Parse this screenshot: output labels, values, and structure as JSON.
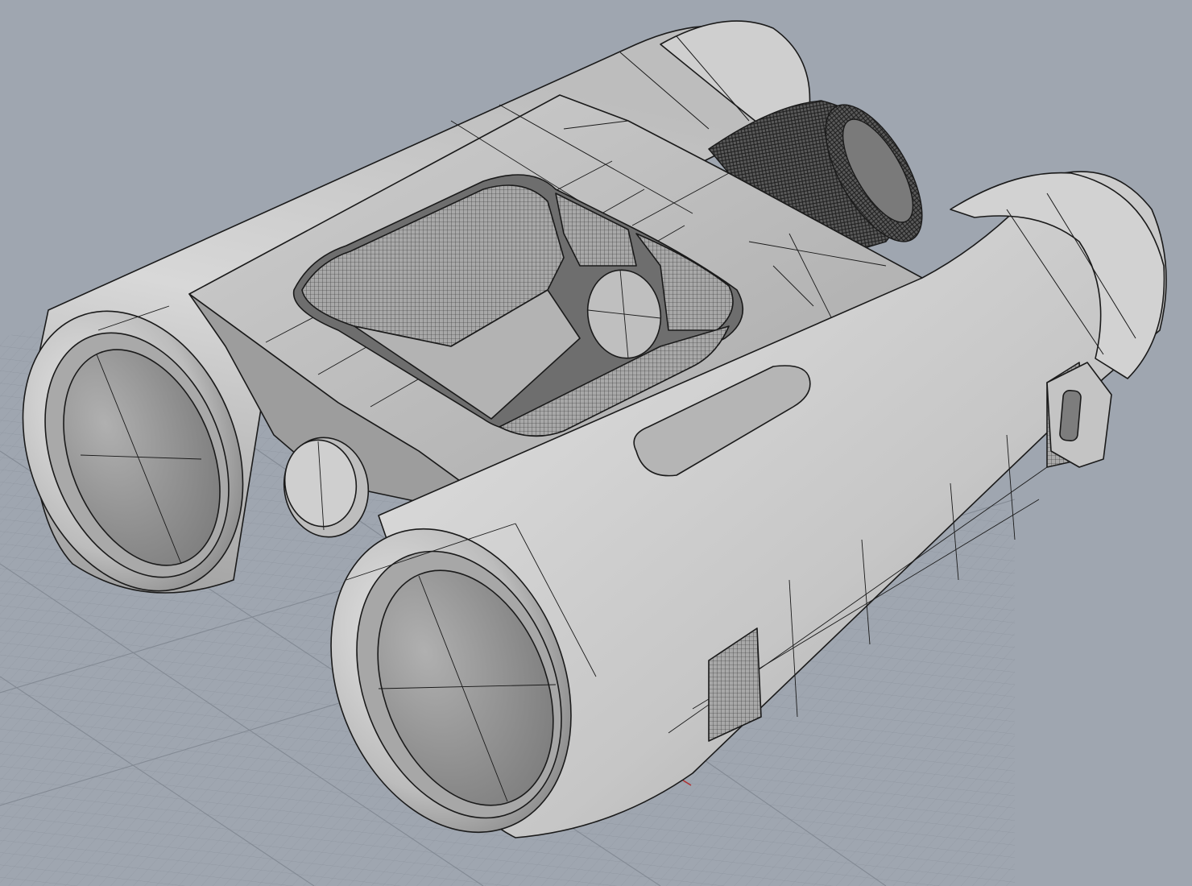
{
  "viewport": {
    "background_color": "#9fa6b0",
    "grid_line_color": "#8d949e",
    "grid_major_color": "#7f8690",
    "projection": "perspective",
    "display_mode": "shaded-with-isocurves"
  },
  "model": {
    "object": "binoculars",
    "body_color": "#c9c9c9",
    "body_highlight_color": "#e6e6e6",
    "body_shadow_color": "#8c8c8c",
    "lens_color": "#9b9b9b",
    "edge_color": "#1a1a1a",
    "knurl_color": "#3a3a3a"
  },
  "axes": {
    "x_axis_color": "#b03030",
    "y_axis_color": "#2aa02a"
  }
}
